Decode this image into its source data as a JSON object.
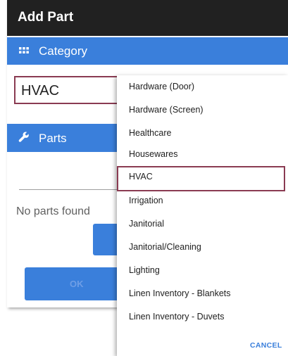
{
  "dialog": {
    "title": "Add Part",
    "category_section": {
      "label": "Category",
      "icon": "grid-icon"
    },
    "category_field": {
      "value": "HVAC"
    },
    "parts_section": {
      "label": "Parts",
      "icon": "wrench-icon"
    },
    "parts_empty_text": "No parts found",
    "ok_button_label": "OK"
  },
  "dropdown": {
    "options": [
      "Hardware (Door)",
      "Hardware (Screen)",
      "Healthcare",
      "Housewares",
      "HVAC",
      "Irrigation",
      "Janitorial",
      "Janitorial/Cleaning",
      "Lighting",
      "Linen Inventory - Blankets",
      "Linen Inventory - Duvets"
    ],
    "selected": "HVAC",
    "cancel_label": "CANCEL"
  },
  "colors": {
    "titlebar": "#212121",
    "accent_blue": "#3a7fdb",
    "selection_border": "#8a3b52"
  }
}
